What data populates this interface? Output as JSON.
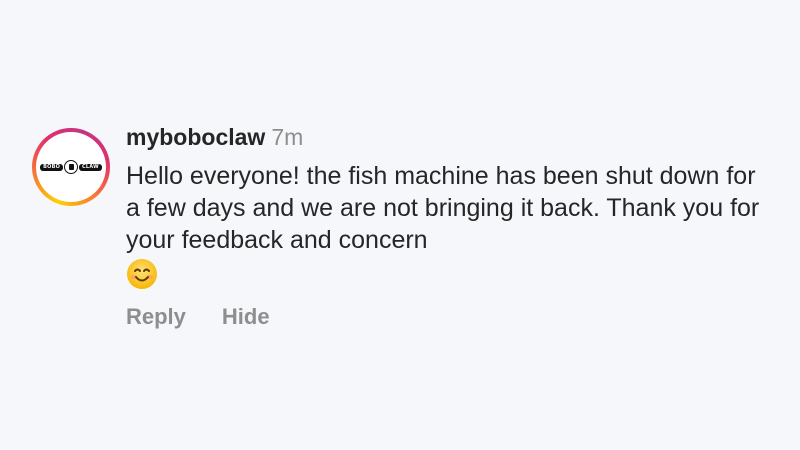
{
  "comment": {
    "avatar_icon": "bobo-claw-logo",
    "avatar_logo_left": "BOBO",
    "avatar_logo_right": "CLAW",
    "username": "myboboclaw",
    "time": "7m",
    "text": "Hello everyone! the fish machine has been shut down for a few days and we are not bringing it back. Thank you for your feedback and concern",
    "emoji": "smiling-face-emoji",
    "actions": {
      "reply": "Reply",
      "hide": "Hide"
    }
  },
  "colors": {
    "background": "#f5f7fa",
    "text": "#262626",
    "muted": "#8e8e8e"
  }
}
